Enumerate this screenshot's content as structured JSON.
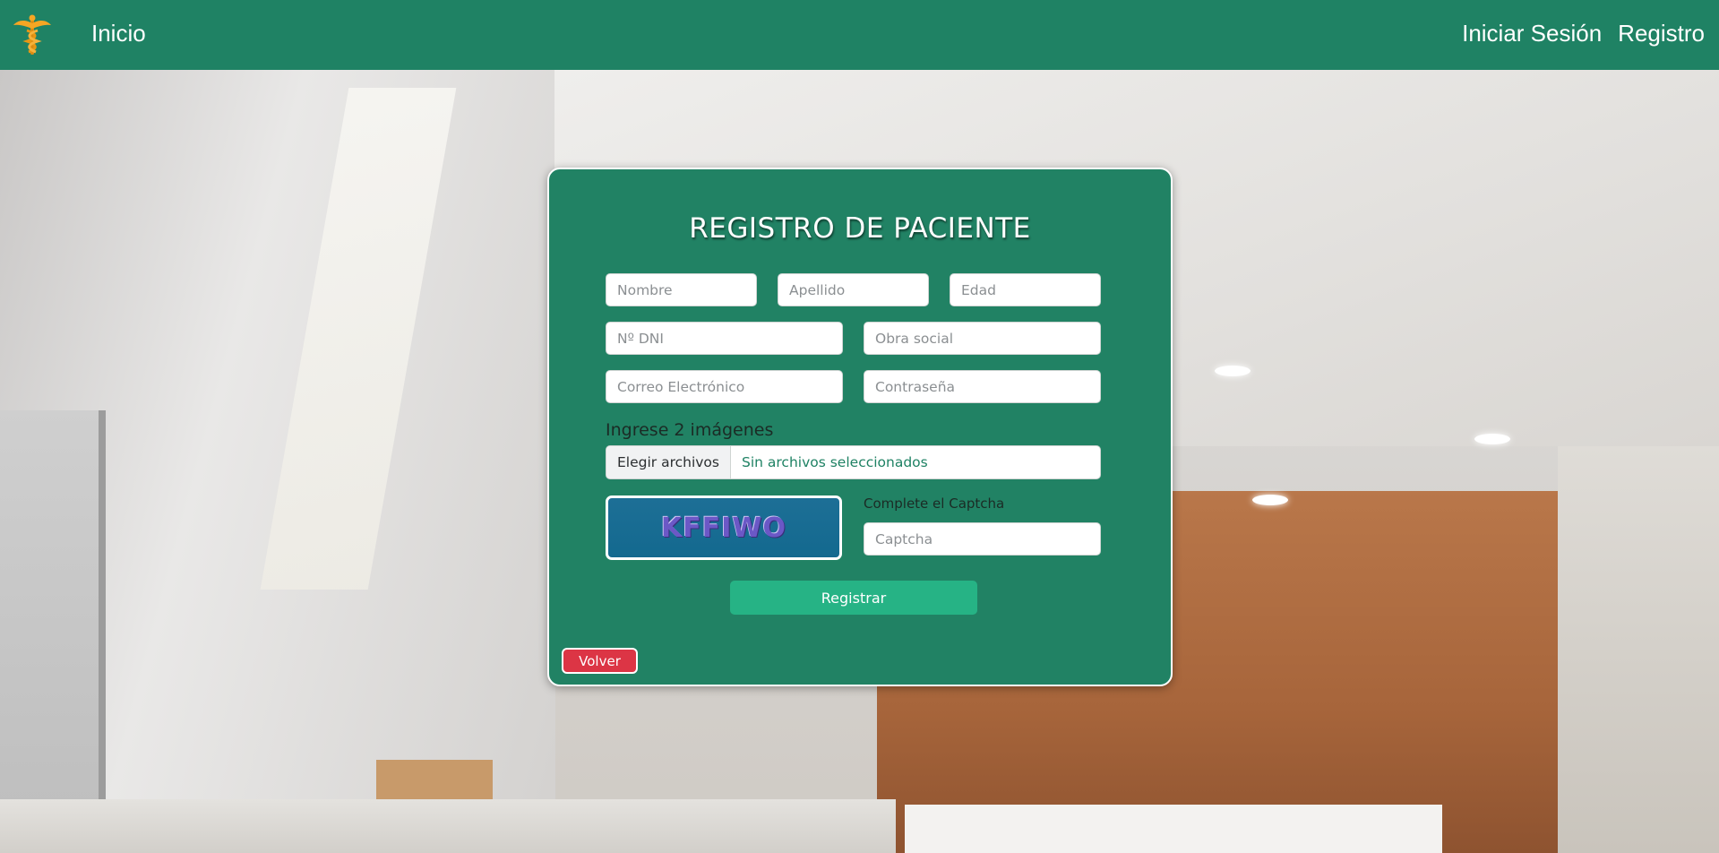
{
  "nav": {
    "home_label": "Inicio",
    "login_label": "Iniciar Sesión",
    "register_label": "Registro"
  },
  "form": {
    "title": "REGISTRO DE PACIENTE",
    "fields": {
      "first_name_placeholder": "Nombre",
      "last_name_placeholder": "Apellido",
      "age_placeholder": "Edad",
      "dni_placeholder": "Nº DNI",
      "insurance_placeholder": "Obra social",
      "email_placeholder": "Correo Electrónico",
      "password_placeholder": "Contraseña"
    },
    "images_label": "Ingrese 2 imágenes",
    "file_button_label": "Elegir archivos",
    "file_status": "Sin archivos seleccionados",
    "captcha_code": "KFFIWO",
    "captcha_label": "Complete el Captcha",
    "captcha_placeholder": "Captcha",
    "submit_label": "Registrar",
    "back_label": "Volver"
  },
  "icons": {
    "logo": "caduceus-icon"
  },
  "colors": {
    "primary": "#1f8264",
    "accent": "#26b385",
    "danger": "#dc3545",
    "captcha_bg": "#13698f",
    "logo": "#f5a623"
  }
}
